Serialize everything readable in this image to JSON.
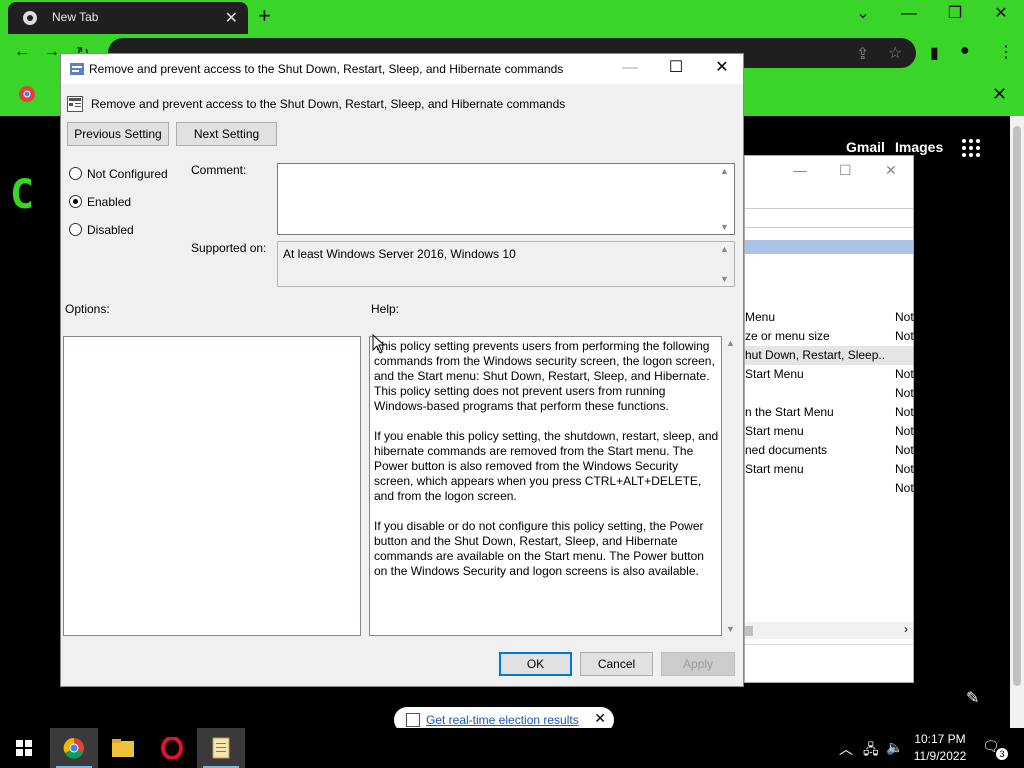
{
  "chrome": {
    "tab_title": "New Tab",
    "links": {
      "gmail": "Gmail",
      "images": "Images"
    },
    "notification_link": "Get real-time election results",
    "accent": "#39d629"
  },
  "gpo_background": {
    "rows": [
      {
        "name": "Menu",
        "state": "Not"
      },
      {
        "name": "ze or menu size",
        "state": "Not"
      },
      {
        "name": "hut Down, Restart, Sleep...",
        "state": ""
      },
      {
        "name": "Start Menu",
        "state": "Not"
      },
      {
        "name": "",
        "state": "Not"
      },
      {
        "name": "n the Start Menu",
        "state": "Not"
      },
      {
        "name": "Start menu",
        "state": "Not"
      },
      {
        "name": "ned documents",
        "state": "Not"
      },
      {
        "name": "Start menu",
        "state": "Not"
      },
      {
        "name": "",
        "state": "Not"
      }
    ]
  },
  "dialog": {
    "window_title": "Remove and prevent access to the Shut Down, Restart, Sleep, and Hibernate commands",
    "setting_title": "Remove and prevent access to the Shut Down, Restart, Sleep, and Hibernate commands",
    "prev_button": "Previous Setting",
    "next_button": "Next Setting",
    "options": [
      {
        "label": "Not Configured",
        "selected": false
      },
      {
        "label": "Enabled",
        "selected": true
      },
      {
        "label": "Disabled",
        "selected": false
      }
    ],
    "comment_label": "Comment:",
    "comment_value": "",
    "supported_label": "Supported on:",
    "supported_value": "At least Windows Server 2016, Windows 10",
    "options_label": "Options:",
    "help_label": "Help:",
    "help_paragraphs": [
      "This policy setting prevents users from performing the following commands from the Windows security screen, the logon screen, and the Start menu: Shut Down, Restart, Sleep, and Hibernate. This policy setting does not prevent users from running Windows-based programs that perform these functions.",
      "If you enable this policy setting, the shutdown, restart, sleep, and hibernate commands are removed from the Start menu. The Power button is also removed from the Windows Security screen, which appears when you press CTRL+ALT+DELETE, and from the logon screen.",
      "If you disable or do not configure this policy setting, the Power button and the Shut Down, Restart, Sleep, and Hibernate commands are available on the Start menu. The Power button on the Windows Security and logon screens is also available."
    ],
    "ok_button": "OK",
    "cancel_button": "Cancel",
    "apply_button": "Apply"
  },
  "taskbar": {
    "time": "10:17 PM",
    "date": "11/9/2022",
    "notification_count": "3"
  }
}
